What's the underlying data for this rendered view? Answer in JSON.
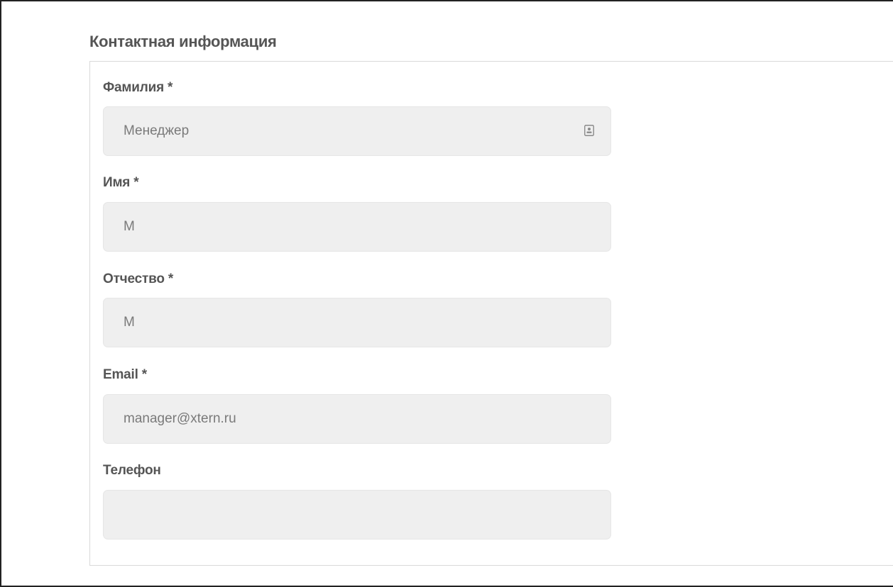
{
  "section": {
    "title": "Контактная информация"
  },
  "fields": [
    {
      "label": "Фамилия *",
      "value": "Менеджер",
      "icon": "contact-card-icon"
    },
    {
      "label": "Имя *",
      "value": "М"
    },
    {
      "label": "Отчество *",
      "value": "М"
    },
    {
      "label": "Email *",
      "value": "manager@xtern.ru"
    },
    {
      "label": "Телефон",
      "value": ""
    }
  ],
  "colors": {
    "label_text": "#555555",
    "input_background": "#efefef",
    "input_text": "#7a7a7a",
    "panel_border": "#d9d9d9"
  }
}
